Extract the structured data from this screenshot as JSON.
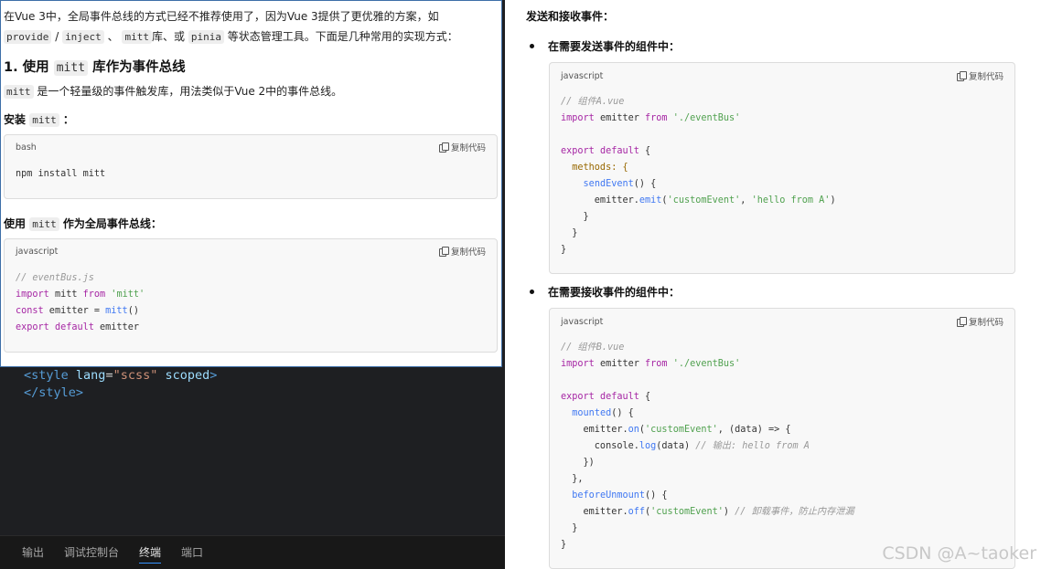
{
  "editor": {
    "code_line1": [
      "<",
      "style",
      " ",
      "lang",
      "=",
      "\"scss\"",
      " ",
      "scoped",
      ">"
    ],
    "code_line2": [
      "</",
      "style",
      ">"
    ],
    "panel_tabs": [
      {
        "label": "输出"
      },
      {
        "label": "调试控制台"
      },
      {
        "label": "终端"
      },
      {
        "label": "端口"
      }
    ]
  },
  "article": {
    "intro_a": "在Vue 3中，全局事件总线的方式已经不推荐使用了，因为Vue 3提供了更优雅的方案，如",
    "intro_code1": "provide",
    "intro_slash": "/",
    "intro_code2": "inject",
    "intro_b": "、",
    "intro_code3": "mitt",
    "intro_c": "库、或",
    "intro_code4": "pinia",
    "intro_d": "等状态管理工具。下面是几种常用的实现方式：",
    "h1_prefix": "1. 使用",
    "h1_code": "mitt",
    "h1_suffix": "库作为事件总线",
    "desc_code": "mitt",
    "desc_text": "是一个轻量级的事件触发库，用法类似于Vue 2中的事件总线。",
    "install_prefix": "安装",
    "install_code": "mitt",
    "install_suffix": "：",
    "bash_box": {
      "lang": "bash",
      "copy_label": "复制代码",
      "line": "npm install mitt"
    },
    "use_prefix": "使用",
    "use_code": "mitt",
    "use_suffix": "作为全局事件总线：",
    "js_box": {
      "lang": "javascript",
      "copy_label": "复制代码",
      "comment": "// eventBus.js",
      "l2": [
        "import",
        " mitt ",
        "from",
        " 'mitt'"
      ],
      "l3": [
        "const",
        " emitter = ",
        "mitt",
        "()"
      ],
      "l4": [
        "export",
        " ",
        "default",
        " emitter"
      ]
    }
  },
  "right": {
    "heading": "发送和接收事件：",
    "send_bullet": "在需要发送事件的组件中：",
    "send_box": {
      "lang": "javascript",
      "copy_label": "复制代码",
      "comment": "// 组件A.vue",
      "import_line": [
        "import",
        " emitter ",
        "from",
        " './eventBus'"
      ],
      "export_line": [
        "export",
        " ",
        "default",
        " {"
      ],
      "methods_line": "  methods: {",
      "send_fn": [
        "    ",
        "sendEvent",
        "() {"
      ],
      "emit_line": [
        "      emitter.",
        "emit",
        "(",
        "'customEvent'",
        ", ",
        "'hello from A'",
        ")"
      ],
      "close1": "    }",
      "close2": "  }",
      "close3": "}"
    },
    "recv_bullet": "在需要接收事件的组件中：",
    "recv_box": {
      "lang": "javascript",
      "copy_label": "复制代码",
      "comment": "// 组件B.vue",
      "import_line": [
        "import",
        " emitter ",
        "from",
        " './eventBus'"
      ],
      "export_line": [
        "export",
        " ",
        "default",
        " {"
      ],
      "mounted_line": [
        "  ",
        "mounted",
        "() {"
      ],
      "on_line": [
        "    emitter.",
        "on",
        "(",
        "'customEvent'",
        ", (data) => {"
      ],
      "log_line": [
        "      console.",
        "log",
        "(data) ",
        "// 输出: hello from A"
      ],
      "close_cb": "    })",
      "close_mounted": "  },",
      "before_line": [
        "  ",
        "beforeUnmount",
        "() {"
      ],
      "off_line": [
        "    emitter.",
        "off",
        "(",
        "'customEvent'",
        ") ",
        "// 卸载事件，防止内存泄漏"
      ],
      "close_before": "  }",
      "close_all": "}"
    }
  },
  "watermark": "CSDN @A~taoker"
}
